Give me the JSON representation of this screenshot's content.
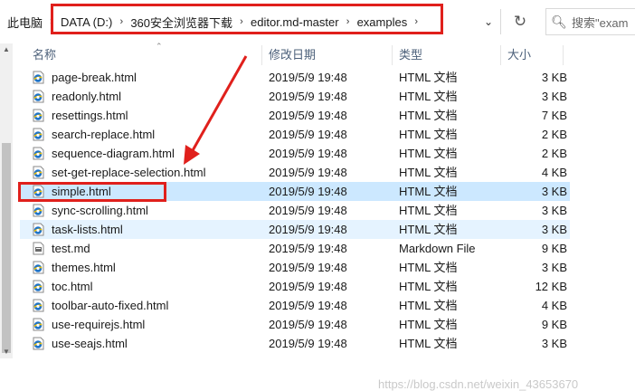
{
  "address": {
    "crumbs": [
      "此电脑",
      "DATA (D:)",
      "360安全浏览器下载",
      "editor.md-master",
      "examples"
    ],
    "search_placeholder": "搜索\"exam"
  },
  "columns": {
    "name": "名称",
    "date": "修改日期",
    "type": "类型",
    "size": "大小"
  },
  "files": [
    {
      "name": "page-break.html",
      "date": "2019/5/9 19:48",
      "type": "HTML 文档",
      "size": "3 KB",
      "icon": "html-file-icon"
    },
    {
      "name": "readonly.html",
      "date": "2019/5/9 19:48",
      "type": "HTML 文档",
      "size": "3 KB",
      "icon": "html-file-icon"
    },
    {
      "name": "resettings.html",
      "date": "2019/5/9 19:48",
      "type": "HTML 文档",
      "size": "7 KB",
      "icon": "html-file-icon"
    },
    {
      "name": "search-replace.html",
      "date": "2019/5/9 19:48",
      "type": "HTML 文档",
      "size": "2 KB",
      "icon": "html-file-icon"
    },
    {
      "name": "sequence-diagram.html",
      "date": "2019/5/9 19:48",
      "type": "HTML 文档",
      "size": "2 KB",
      "icon": "html-file-icon"
    },
    {
      "name": "set-get-replace-selection.html",
      "date": "2019/5/9 19:48",
      "type": "HTML 文档",
      "size": "4 KB",
      "icon": "html-file-icon"
    },
    {
      "name": "simple.html",
      "date": "2019/5/9 19:48",
      "type": "HTML 文档",
      "size": "3 KB",
      "icon": "html-file-icon",
      "state": "selected"
    },
    {
      "name": "sync-scrolling.html",
      "date": "2019/5/9 19:48",
      "type": "HTML 文档",
      "size": "3 KB",
      "icon": "html-file-icon"
    },
    {
      "name": "task-lists.html",
      "date": "2019/5/9 19:48",
      "type": "HTML 文档",
      "size": "3 KB",
      "icon": "html-file-icon",
      "state": "hovered"
    },
    {
      "name": "test.md",
      "date": "2019/5/9 19:48",
      "type": "Markdown File",
      "size": "9 KB",
      "icon": "markdown-file-icon"
    },
    {
      "name": "themes.html",
      "date": "2019/5/9 19:48",
      "type": "HTML 文档",
      "size": "3 KB",
      "icon": "html-file-icon"
    },
    {
      "name": "toc.html",
      "date": "2019/5/9 19:48",
      "type": "HTML 文档",
      "size": "12 KB",
      "icon": "html-file-icon"
    },
    {
      "name": "toolbar-auto-fixed.html",
      "date": "2019/5/9 19:48",
      "type": "HTML 文档",
      "size": "4 KB",
      "icon": "html-file-icon"
    },
    {
      "name": "use-requirejs.html",
      "date": "2019/5/9 19:48",
      "type": "HTML 文档",
      "size": "9 KB",
      "icon": "html-file-icon"
    },
    {
      "name": "use-seajs.html",
      "date": "2019/5/9 19:48",
      "type": "HTML 文档",
      "size": "3 KB",
      "icon": "html-file-icon"
    }
  ],
  "watermark": "https://blog.csdn.net/weixin_43653670",
  "colors": {
    "selected": "#cce8ff",
    "hover": "#e5f3ff",
    "annotation": "#e0201c",
    "header_text": "#4c607a"
  }
}
